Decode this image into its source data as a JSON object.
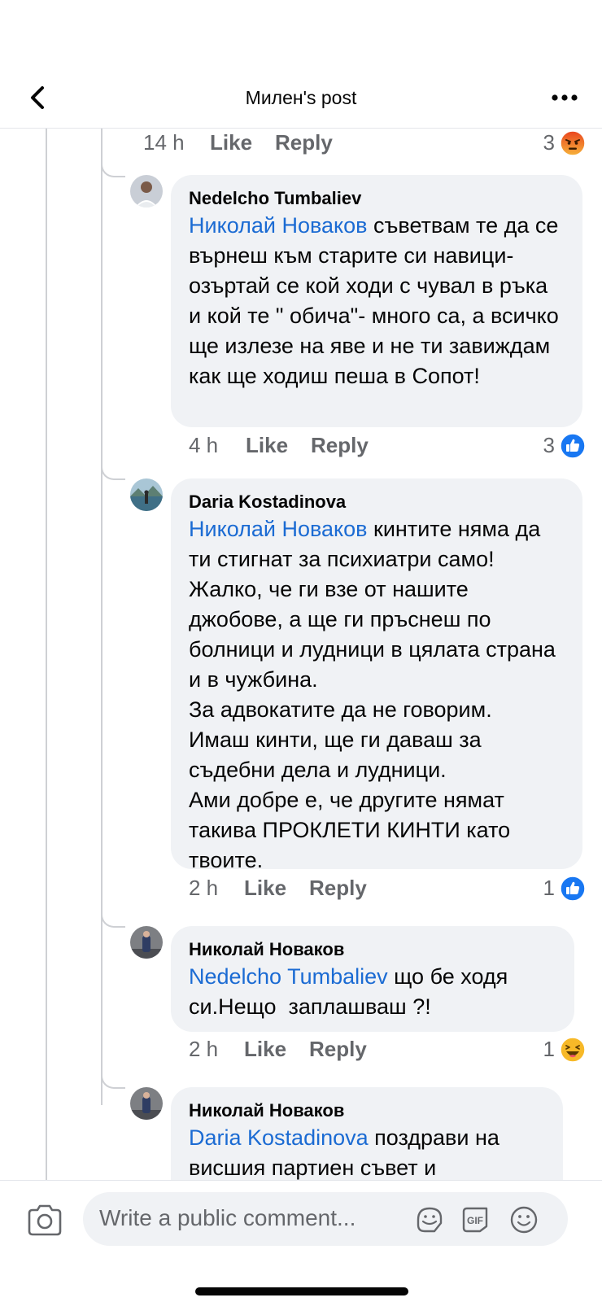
{
  "header": {
    "title": "Милен's post"
  },
  "comments": [
    {
      "time": "14 h",
      "like": "Like",
      "reply": "Reply",
      "reaction_count": "3",
      "reaction": "angry-icon"
    },
    {
      "author": "Nedelcho Tumbaliev",
      "mention": "Николай Новаков",
      "text": " съветвам те да се върнеш към старите си навици- озъртай се кой ходи с чувал в ръка и кой те \" обича\"- много са, а всичко ще излезе на яве и не ти завиждам как ще ходиш пеша в Сопот!",
      "time": "4 h",
      "like": "Like",
      "reply": "Reply",
      "reaction_count": "3",
      "reaction": "like-icon"
    },
    {
      "author": "Daria Kostadinova",
      "mention": "Николай Новаков",
      "text": " кинтите няма да ти стигнат за психиатри само! Жалко, че ги взе от нашите джобове, а ще ги пръснеш по болници и лудници в цялата страна и в чужбина.\nЗа адвокатите да не говорим.\nИмаш кинти, ще ги даваш за съдебни дела и лудници.\nАми добре е, че другите нямат такива ПРОКЛЕТИ КИНТИ като твоите.",
      "time": "2 h",
      "like": "Like",
      "reply": "Reply",
      "reaction_count": "1",
      "reaction": "like-icon"
    },
    {
      "author": "Николай Новаков",
      "mention": "Nedelcho Tumbaliev",
      "text": " що бе ходя си.Нещо  заплашваш ?!",
      "time": "2 h",
      "like": "Like",
      "reply": "Reply",
      "reaction_count": "1",
      "reaction": "haha-icon"
    },
    {
      "author": "Николай Новаков",
      "mention": "Daria Kostadinova",
      "text": " поздрави на висшия партиен съвет и"
    }
  ],
  "composer": {
    "placeholder": "Write a public comment..."
  },
  "colors": {
    "mention": "#1b6bd3",
    "like_blue": "#1877f2",
    "bubble": "#f0f2f5",
    "meta": "#65676b"
  }
}
